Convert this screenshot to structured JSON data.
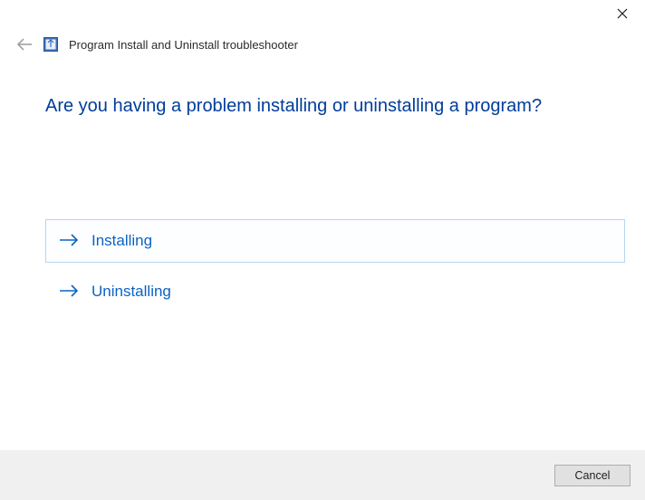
{
  "header": {
    "app_title": "Program Install and Uninstall troubleshooter"
  },
  "main": {
    "heading": "Are you having a problem installing or uninstalling a program?",
    "options": [
      {
        "label": "Installing",
        "selected": true
      },
      {
        "label": "Uninstalling",
        "selected": false
      }
    ]
  },
  "footer": {
    "cancel_label": "Cancel"
  }
}
